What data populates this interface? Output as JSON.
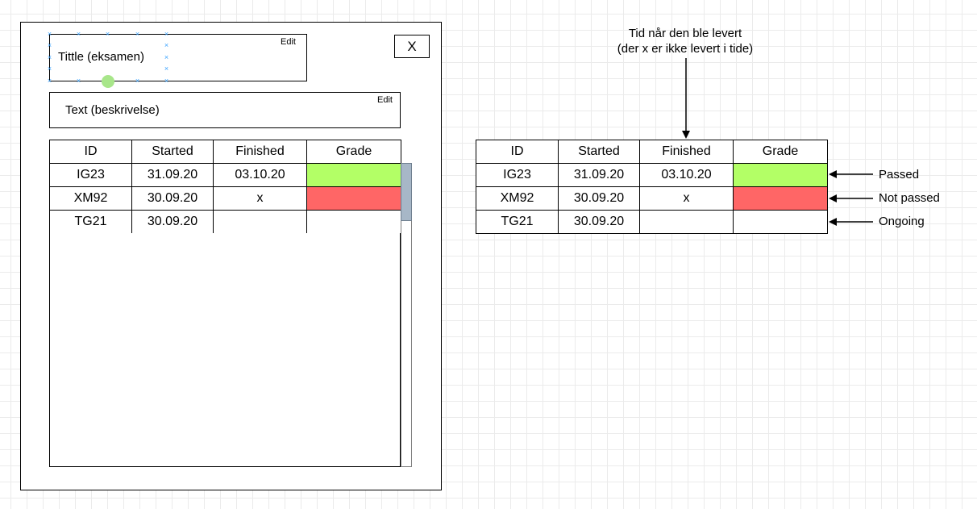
{
  "dialog": {
    "title": "Tittle (eksamen)",
    "description": "Text (beskrivelse)",
    "edit_label": "Edit",
    "close_label": "X"
  },
  "table": {
    "headers": [
      "ID",
      "Started",
      "Finished",
      "Grade"
    ],
    "rows": [
      {
        "id": "IG23",
        "started": "31.09.20",
        "finished": "03.10.20",
        "status": "passed"
      },
      {
        "id": "XM92",
        "started": "30.09.20",
        "finished": "x",
        "status": "failed"
      },
      {
        "id": "TG21",
        "started": "30.09.20",
        "finished": "",
        "status": "ongoing"
      }
    ]
  },
  "annotations": {
    "note_line1": "Tid når den ble levert",
    "note_line2": "(der x er ikke levert i tide)",
    "legend": [
      "Passed",
      "Not passed",
      "Ongoing"
    ]
  },
  "colors": {
    "passed": "#b3ff66",
    "failed": "#ff6666",
    "ongoing": "#ffffff",
    "selection_handles": "#3aa3ff"
  }
}
